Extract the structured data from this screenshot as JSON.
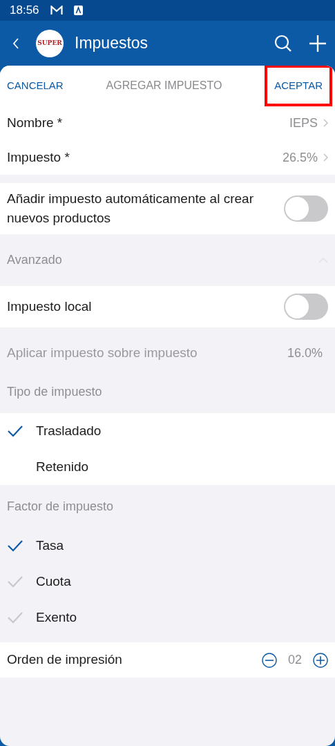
{
  "status_bar": {
    "time": "18:56"
  },
  "app_bar": {
    "logo_text": "SUPER",
    "title": "Impuestos"
  },
  "sheet_header": {
    "cancel": "CANCELAR",
    "title": "AGREGAR IMPUESTO",
    "accept": "ACEPTAR",
    "accept_highlighted": true
  },
  "fields": [
    {
      "label": "Nombre *",
      "value": "IEPS"
    },
    {
      "label": "Impuesto *",
      "value": "26.5%"
    }
  ],
  "auto_add": {
    "label": "Añadir impuesto automáticamente al crear nuevos productos",
    "on": false
  },
  "advanced": {
    "label": "Avanzado",
    "expanded": true
  },
  "local_tax": {
    "label": "Impuesto local",
    "on": false
  },
  "tax_on_tax": {
    "label": "Aplicar impuesto sobre impuesto",
    "value": "16.0%",
    "disabled": true
  },
  "groups": [
    {
      "title": "Tipo de impuesto",
      "disabled": false,
      "options": [
        {
          "label": "Trasladado",
          "selected": true
        },
        {
          "label": "Retenido",
          "selected": false
        }
      ]
    },
    {
      "title": "Factor de impuesto",
      "disabled": true,
      "options": [
        {
          "label": "Tasa",
          "selected": true
        },
        {
          "label": "Cuota",
          "selected": false
        },
        {
          "label": "Exento",
          "selected": false
        }
      ]
    }
  ],
  "print_order": {
    "label": "Orden de impresión",
    "value": "02"
  }
}
